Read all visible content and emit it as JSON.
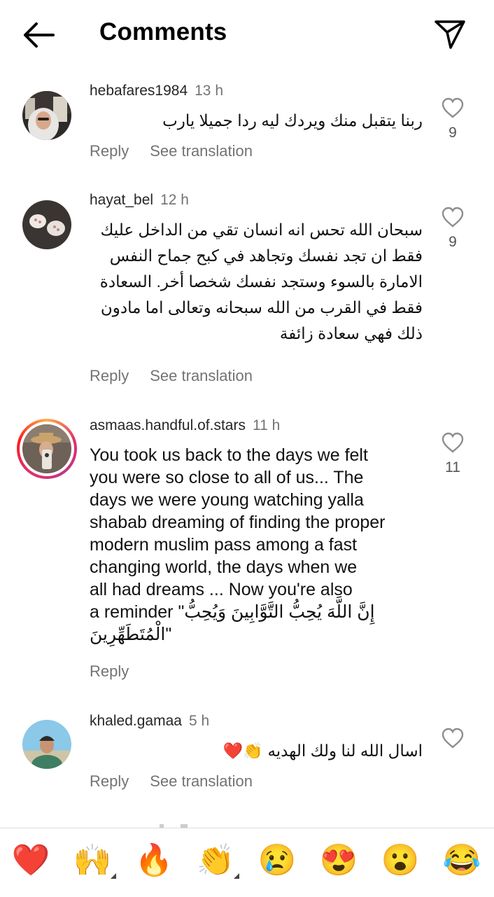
{
  "header": {
    "title": "Comments"
  },
  "comments": [
    {
      "username": "hebafares1984",
      "time": "13 h",
      "text": "ربنا يتقبل منك ويردك ليه ردا جميلا يارب",
      "likes": "9",
      "reply": "Reply",
      "see_translation": "See translation"
    },
    {
      "username": "hayat_bel",
      "time": "12 h",
      "lines": [
        "سبحان الله تحس انه انسان تقي من الداخل عليك",
        "فقط ان تجد نفسك وتجاهد في كبح جماح النفس",
        "الامارة بالسوء وستجد نفسك شخصا أخر. السعادة",
        "فقط في القرب من الله سبحانه وتعالى اما مادون",
        "ذلك فهي سعادة زائفة"
      ],
      "likes": "9",
      "reply": "Reply",
      "see_translation": "See translation"
    },
    {
      "username": "asmaas.handful.of.stars",
      "time": "11 h",
      "lines": [
        "You took us back to the days we felt",
        "you were so close to all of us... The",
        "days we were young watching yalla",
        "shabab dreaming of finding the proper",
        "modern muslim pass among a fast",
        "changing world, the days when we",
        "all had dreams ... Now you're also",
        "a reminder \"إِنَّ اللَّهَ يُحِبُّ التَّوَّابِينَ وَيُحِبُّ",
        "الْمُتَطَهِّرِينَ\""
      ],
      "likes": "11",
      "reply": "Reply"
    },
    {
      "username": "khaled.gamaa",
      "time": "5 h",
      "text": "اسال الله لنا ولك الهديه 👏❤️",
      "reply": "Reply",
      "see_translation": "See translation"
    }
  ],
  "emoji_bar": [
    "❤️",
    "🙌",
    "🔥",
    "👏",
    "😢",
    "😍",
    "😮",
    "😂"
  ],
  "colors": {
    "meta_gray": "#737373",
    "heart_red": "#e0245e",
    "ring_gradient": [
      "#fcaf45",
      "#e1306c",
      "#c13584"
    ]
  }
}
